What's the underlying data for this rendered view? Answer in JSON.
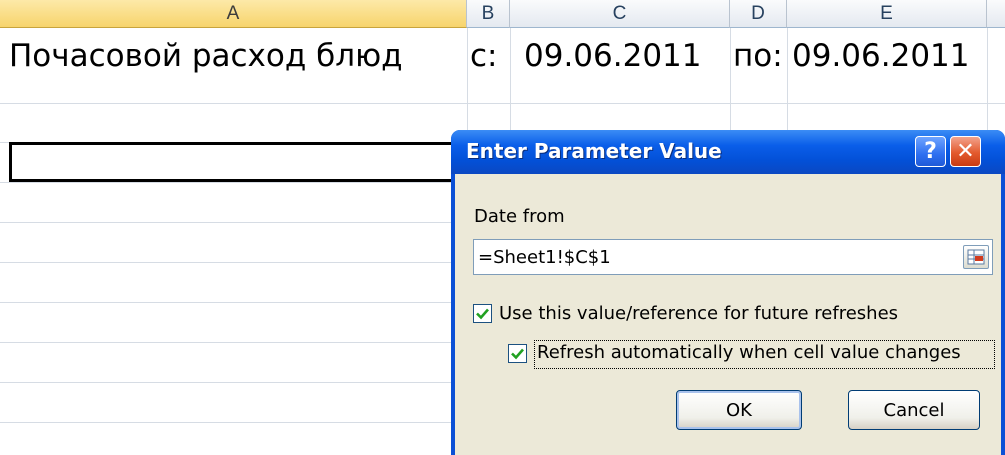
{
  "sheet": {
    "columns": [
      "A",
      "B",
      "C",
      "D",
      "E"
    ],
    "row1": {
      "a": "Почасовой расход блюд",
      "b": "с:",
      "c": "09.06.2011",
      "d": "по:",
      "e": "09.06.2011"
    }
  },
  "dialog": {
    "title": "Enter Parameter Value",
    "help_label": "?",
    "close_label": "✕",
    "field_label": "Date from",
    "field_value": "=Sheet1!$C$1",
    "checkbox1": {
      "label": "Use this value/reference for future refreshes",
      "checked": true
    },
    "checkbox2": {
      "label": "Refresh automatically when cell value changes",
      "checked": true
    },
    "ok_label": "OK",
    "cancel_label": "Cancel"
  }
}
